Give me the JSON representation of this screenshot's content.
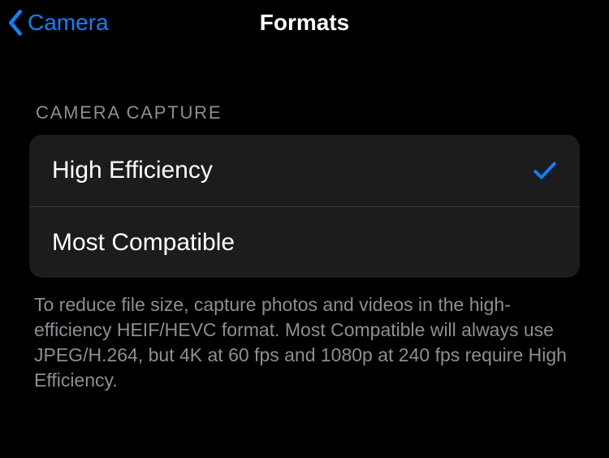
{
  "nav": {
    "back_label": "Camera",
    "title": "Formats"
  },
  "section": {
    "header": "CAMERA CAPTURE",
    "footer": "To reduce file size, capture photos and videos in the high-efficiency HEIF/HEVC format. Most Compatible will always use JPEG/H.264, but 4K at 60 fps and 1080p at 240 fps require High Efficiency.",
    "options": [
      {
        "label": "High Efficiency",
        "selected": true
      },
      {
        "label": "Most Compatible",
        "selected": false
      }
    ]
  }
}
